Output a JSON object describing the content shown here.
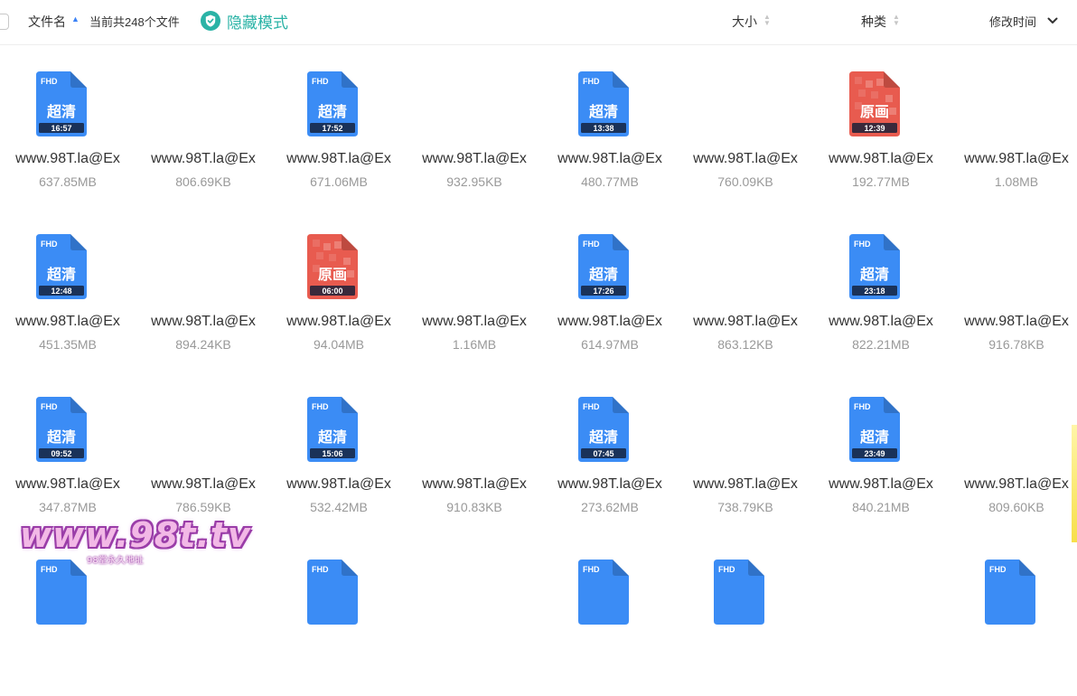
{
  "header": {
    "file_name_label": "文件名",
    "file_count": "当前共248个文件",
    "hide_mode_label": "隐藏模式",
    "size_label": "大小",
    "type_label": "种类",
    "modified_label": "修改时间"
  },
  "colors": {
    "accent_teal": "#2ab3a6",
    "file_blue": "#3b8cf5",
    "file_red": "#e85b4f",
    "sort_blue": "#3b82f6"
  },
  "files": [
    {
      "name": "www.98T.la@Ex",
      "size": "637.85MB",
      "thumb": "blue",
      "badge": "FHD",
      "quality": "超清",
      "duration": "16:57"
    },
    {
      "name": "www.98T.la@Ex",
      "size": "806.69KB",
      "thumb": "none"
    },
    {
      "name": "www.98T.la@Ex",
      "size": "671.06MB",
      "thumb": "blue",
      "badge": "FHD",
      "quality": "超清",
      "duration": "17:52"
    },
    {
      "name": "www.98T.la@Ex",
      "size": "932.95KB",
      "thumb": "none"
    },
    {
      "name": "www.98T.la@Ex",
      "size": "480.77MB",
      "thumb": "blue",
      "badge": "FHD",
      "quality": "超清",
      "duration": "13:38"
    },
    {
      "name": "www.98T.la@Ex",
      "size": "760.09KB",
      "thumb": "none"
    },
    {
      "name": "www.98T.la@Ex",
      "size": "192.77MB",
      "thumb": "red",
      "badge": "",
      "quality": "原画",
      "duration": "12:39"
    },
    {
      "name": "www.98T.la@Ex",
      "size": "1.08MB",
      "thumb": "none"
    },
    {
      "name": "www.98T.la@Ex",
      "size": "451.35MB",
      "thumb": "blue",
      "badge": "FHD",
      "quality": "超清",
      "duration": "12:48"
    },
    {
      "name": "www.98T.la@Ex",
      "size": "894.24KB",
      "thumb": "none"
    },
    {
      "name": "www.98T.la@Ex",
      "size": "94.04MB",
      "thumb": "red",
      "badge": "",
      "quality": "原画",
      "duration": "06:00"
    },
    {
      "name": "www.98T.la@Ex",
      "size": "1.16MB",
      "thumb": "none"
    },
    {
      "name": "www.98T.la@Ex",
      "size": "614.97MB",
      "thumb": "blue",
      "badge": "FHD",
      "quality": "超清",
      "duration": "17:26"
    },
    {
      "name": "www.98T.la@Ex",
      "size": "863.12KB",
      "thumb": "none"
    },
    {
      "name": "www.98T.la@Ex",
      "size": "822.21MB",
      "thumb": "blue",
      "badge": "FHD",
      "quality": "超清",
      "duration": "23:18"
    },
    {
      "name": "www.98T.la@Ex",
      "size": "916.78KB",
      "thumb": "none"
    },
    {
      "name": "www.98T.la@Ex",
      "size": "347.87MB",
      "thumb": "blue",
      "badge": "FHD",
      "quality": "超清",
      "duration": "09:52"
    },
    {
      "name": "www.98T.la@Ex",
      "size": "786.59KB",
      "thumb": "none"
    },
    {
      "name": "www.98T.la@Ex",
      "size": "532.42MB",
      "thumb": "blue",
      "badge": "FHD",
      "quality": "超清",
      "duration": "15:06"
    },
    {
      "name": "www.98T.la@Ex",
      "size": "910.83KB",
      "thumb": "none"
    },
    {
      "name": "www.98T.la@Ex",
      "size": "273.62MB",
      "thumb": "blue",
      "badge": "FHD",
      "quality": "超清",
      "duration": "07:45"
    },
    {
      "name": "www.98T.la@Ex",
      "size": "738.79KB",
      "thumb": "none"
    },
    {
      "name": "www.98T.la@Ex",
      "size": "840.21MB",
      "thumb": "blue",
      "badge": "FHD",
      "quality": "超清",
      "duration": "23:49"
    },
    {
      "name": "www.98T.la@Ex",
      "size": "809.60KB",
      "thumb": "none"
    },
    {
      "thumb": "blue",
      "badge": "FHD"
    },
    {
      "thumb": "none"
    },
    {
      "thumb": "blue",
      "badge": "FHD"
    },
    {
      "thumb": "none"
    },
    {
      "thumb": "blue",
      "badge": "FHD"
    },
    {
      "thumb": "blue",
      "badge": "FHD"
    },
    {
      "thumb": "none"
    },
    {
      "thumb": "blue",
      "badge": "FHD"
    }
  ],
  "watermark": {
    "text": "www.98t.tv",
    "subtext": "98堂永久地址"
  }
}
